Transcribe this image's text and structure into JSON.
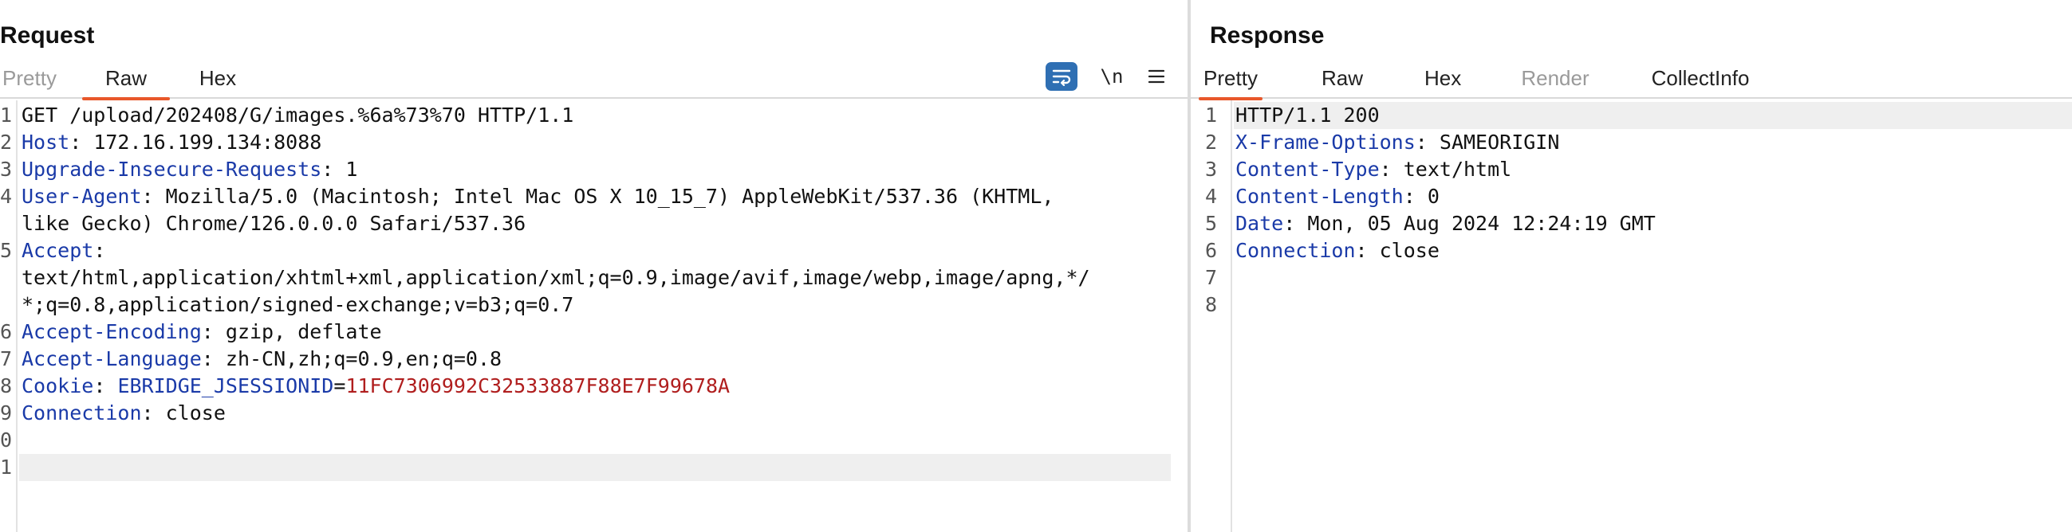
{
  "request": {
    "title": "Request",
    "tabs": [
      "Pretty",
      "Raw",
      "Hex"
    ],
    "active_tab": "Raw",
    "toolbar": {
      "wrap_icon": "wrap-lines-icon",
      "newline_label": "\\n",
      "menu_icon": "hamburger-menu-icon"
    },
    "lines": [
      {
        "n": "1",
        "text": "GET /upload/202408/G/images.%6a%73%70 HTTP/1.1"
      },
      {
        "n": "2",
        "key": "Host",
        "value": " 172.16.199.134:8088"
      },
      {
        "n": "3",
        "key": "Upgrade-Insecure-Requests",
        "value": " 1"
      },
      {
        "n": "4",
        "key": "User-Agent",
        "value": " Mozilla/5.0 (Macintosh; Intel Mac OS X 10_15_7) AppleWebKit/537.36 (KHTML,"
      },
      {
        "n": "",
        "text": "like Gecko) Chrome/126.0.0.0 Safari/537.36"
      },
      {
        "n": "5",
        "key": "Accept",
        "value": ""
      },
      {
        "n": "",
        "text": "text/html,application/xhtml+xml,application/xml;q=0.9,image/avif,image/webp,image/apng,*/"
      },
      {
        "n": "",
        "text": "*;q=0.8,application/signed-exchange;v=b3;q=0.7"
      },
      {
        "n": "6",
        "key": "Accept-Encoding",
        "value": " gzip, deflate"
      },
      {
        "n": "7",
        "key": "Accept-Language",
        "value": " zh-CN,zh;q=0.9,en;q=0.8"
      },
      {
        "n": "8",
        "key": "Cookie",
        "value": " ",
        "cookie_name": "EBRIDGE_JSESSIONID",
        "cookie_eq": "=",
        "cookie_value": "11FC7306992C32533887F88E7F99678A"
      },
      {
        "n": "9",
        "key": "Connection",
        "value": " close"
      },
      {
        "n": "0",
        "text": ""
      },
      {
        "n": "1",
        "text": ""
      }
    ]
  },
  "response": {
    "title": "Response",
    "tabs": [
      "Pretty",
      "Raw",
      "Hex",
      "Render",
      "CollectInfo"
    ],
    "active_tab": "Pretty",
    "disabled_tabs": [
      "Render"
    ],
    "lines": [
      {
        "n": "1",
        "text": "HTTP/1.1 200"
      },
      {
        "n": "2",
        "key": "X-Frame-Options",
        "value": " SAMEORIGIN"
      },
      {
        "n": "3",
        "key": "Content-Type",
        "value": " text/html"
      },
      {
        "n": "4",
        "key": "Content-Length",
        "value": " 0"
      },
      {
        "n": "5",
        "key": "Date",
        "value": " Mon, 05 Aug 2024 12:24:19 GMT"
      },
      {
        "n": "6",
        "key": "Connection",
        "value": " close"
      },
      {
        "n": "7",
        "text": ""
      },
      {
        "n": "8",
        "text": ""
      }
    ]
  },
  "colors": {
    "header_key": "#1a3aa8",
    "cookie_value": "#b01e1e",
    "active_tab_underline": "#e8572a",
    "wrap_button_bg": "#2f6fb3"
  }
}
